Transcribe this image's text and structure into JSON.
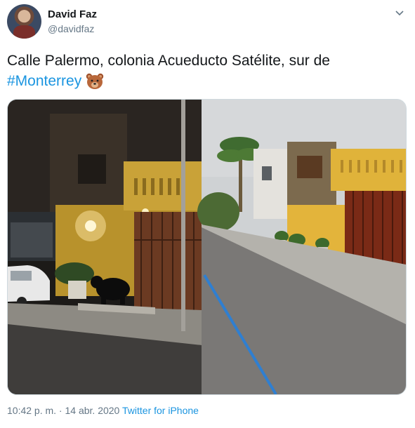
{
  "user": {
    "name": "David Faz",
    "handle": "@davidfaz"
  },
  "tweet": {
    "text": "Calle Palermo, colonia Acueducto Satélite, sur de",
    "hashtag": "#Monterrey",
    "emoji": "bear-face-emoji"
  },
  "meta": {
    "time": "10:42 p. m.",
    "separator": " · ",
    "date": "14 abr. 2020",
    "source": "Twitter for iPhone"
  },
  "icons": {
    "caret": "chevron-down-icon"
  },
  "colors": {
    "link": "#1b95e0",
    "secondary": "#657786",
    "text": "#14171a"
  }
}
